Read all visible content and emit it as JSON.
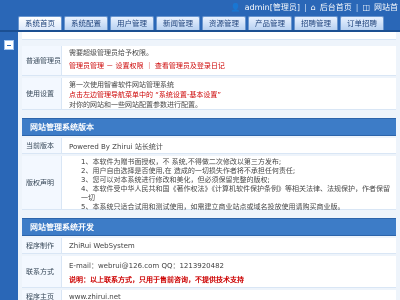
{
  "header": {
    "user_label": "admin[管理员]",
    "back_home": "后台首页",
    "front_home": "网站首",
    "tabs": [
      "系统首页",
      "系统配置",
      "用户管理",
      "新闻管理",
      "资源管理",
      "产品管理",
      "招聘管理",
      "订单招聘"
    ]
  },
  "rows": {
    "ordinary_admin": {
      "label": "普通管理员",
      "text1": "需要超级管理员给予权限。",
      "text2_links": "管理员管理 － 设置权限  ｜  查看管理员及登录日记"
    },
    "usage": {
      "label": "使用设置",
      "line1": "第一次使用智睿软件网站管理系统",
      "line2": "点击左边管理导航菜单中的 “系统设置-基本设置”",
      "line3": "对你的网站和一些网站配置参数进行配置。"
    }
  },
  "sections": {
    "version_title": "网站管理系统版本",
    "dev_title": "网站管理系统开发"
  },
  "version": {
    "current_label": "当前版本",
    "current_value": "Powered By Zhirui 站长统计",
    "copyright_label": "版权声明",
    "copyright_items": [
      "1、本软件为赠书面授权，不                    系统,不得做二次修改以第三方发布;",
      "2、用户自由选择是否使用,在                   造成的一切损失作者将不承担任何责任;",
      "3、您可以对本系统进行修改和美化，但必须保留完整的版权;",
      "4、本软件受中华人民共和国《著作权法》《计算机软件保护条例》等相关法律、法规保护，作者保留一切",
      "5、本系统只适合试用和测试使用，如需建立商业站点或域名投放使用请购买商业版。"
    ]
  },
  "dev": {
    "maker_label": "程序制作",
    "maker_value": "ZhiRui WebSystem",
    "contact_label": "联系方式",
    "email_line": "E-mail：webrui@126.com     QQ：1213920482",
    "note_line": "说明：以上联系方式，只用于售前咨询，不提供技术支持",
    "home_label": "程序主页",
    "home_value": "www.zhirui.net"
  }
}
